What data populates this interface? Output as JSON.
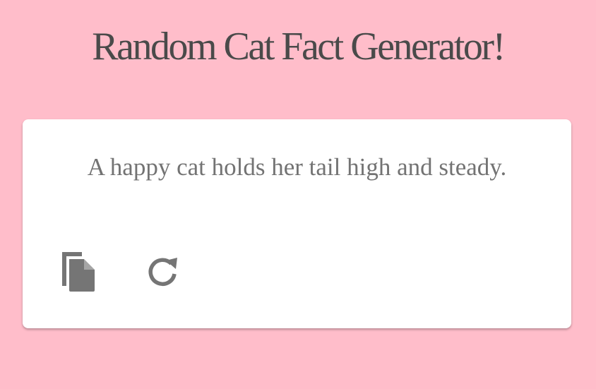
{
  "page": {
    "title": "Random Cat Fact Generator!"
  },
  "card": {
    "fact_text": "A happy cat holds her tail high and steady."
  },
  "actions": {
    "copy_icon": "copy-icon",
    "refresh_icon": "refresh-icon"
  },
  "colors": {
    "background": "#ffbdca",
    "card": "#ffffff",
    "title_text": "#4a4a4a",
    "fact_text": "#737373",
    "icon": "#757575"
  }
}
